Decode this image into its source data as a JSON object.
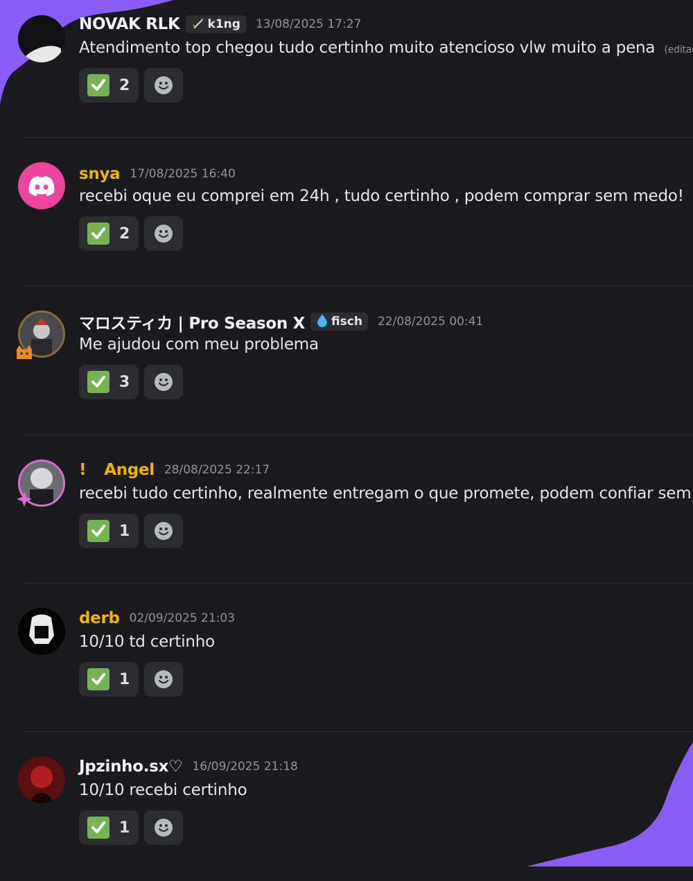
{
  "colors": {
    "background": "#1b1b1f",
    "accent_purple": "#8a5cf6",
    "check_green": "#77b255",
    "username_yellow": "#f0b400"
  },
  "messages": [
    {
      "username": "NOVAK RLK",
      "tag": {
        "icon": "sword-icon",
        "label": "k1ng"
      },
      "timestamp": "13/08/2025 17:27",
      "content": "Atendimento top chegou tudo certinho muito atencioso vlw muito a pena",
      "edited_label": "(editad",
      "reaction": {
        "emoji": "check-mark",
        "count": "2"
      }
    },
    {
      "username": "snya",
      "timestamp": "17/08/2025 16:40",
      "content": "recebi oque eu comprei em 24h , tudo certinho  , podem comprar sem medo!",
      "reaction": {
        "emoji": "check-mark",
        "count": "2"
      }
    },
    {
      "username": "マロスティカ | Pro Season X",
      "tag": {
        "icon": "water-drop-icon",
        "label": "fisch"
      },
      "timestamp": "22/08/2025 00:41",
      "content": "Me ajudou com meu problema",
      "reaction": {
        "emoji": "check-mark",
        "count": "3"
      }
    },
    {
      "username_prefix": "!",
      "username": "Angel",
      "timestamp": "28/08/2025 22:17",
      "content": "recebi tudo certinho, realmente entregam o que promete, podem confiar sem r",
      "reaction": {
        "emoji": "check-mark",
        "count": "1"
      }
    },
    {
      "username": "derb",
      "timestamp": "02/09/2025 21:03",
      "content": "10/10 td certinho",
      "reaction": {
        "emoji": "check-mark",
        "count": "1"
      }
    },
    {
      "username": "Jpzinho.sx♡",
      "timestamp": "16/09/2025 21:18",
      "content": "10/10 recebi certinho",
      "reaction": {
        "emoji": "check-mark",
        "count": "1"
      }
    }
  ]
}
